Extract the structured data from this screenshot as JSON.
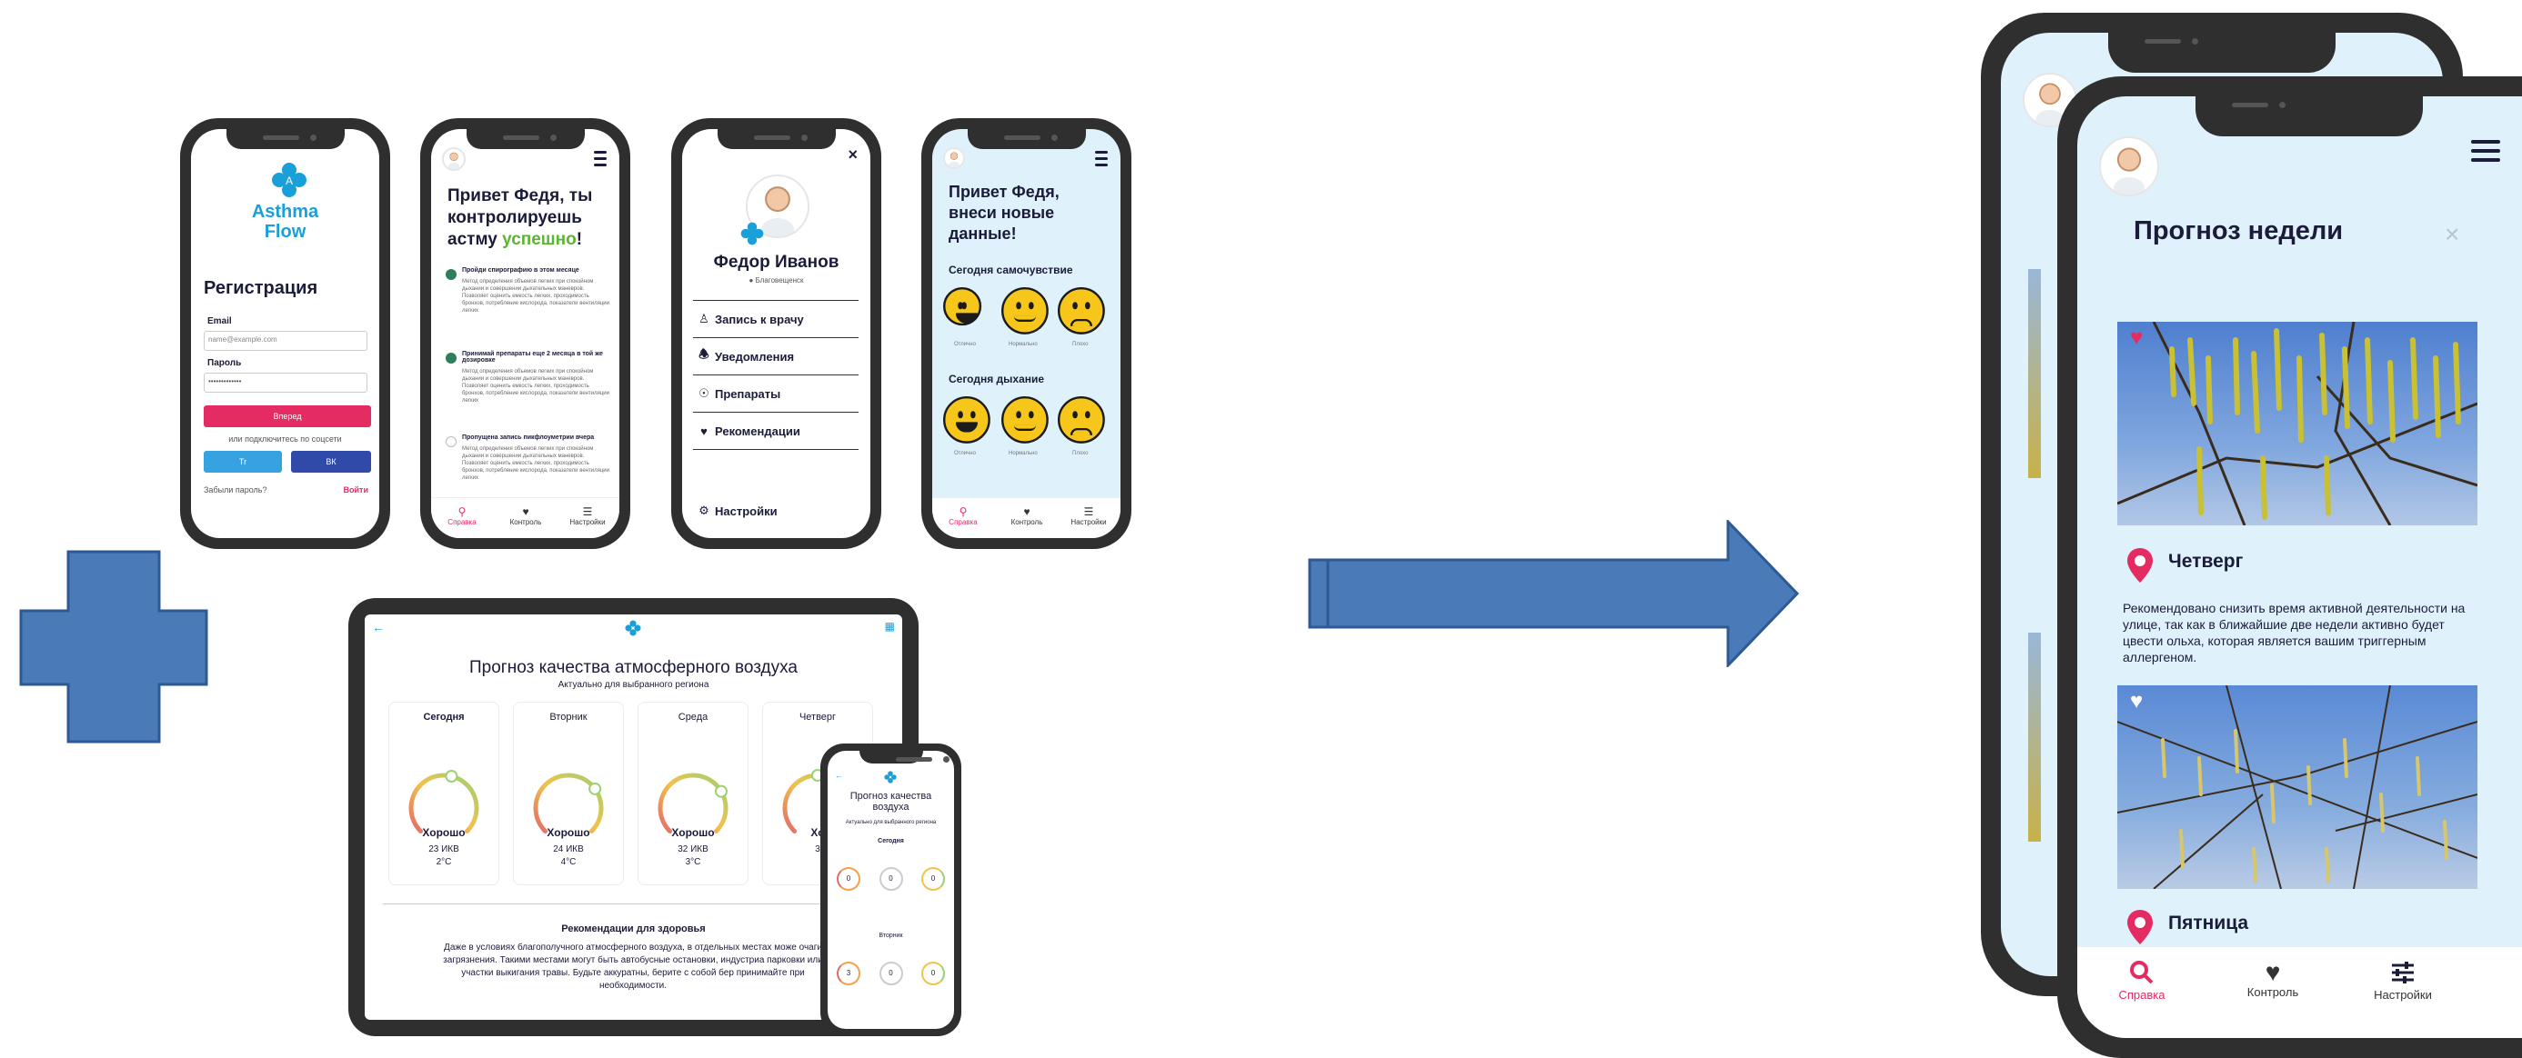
{
  "registration": {
    "logo_line1": "Asthma",
    "logo_line2": "Flow",
    "title": "Регистрация",
    "email_label": "Email",
    "email_placeholder": "name@example.com",
    "password_label": "Пароль",
    "password_value": "•••••••••••••",
    "submit": "Вперед",
    "social_text": "или подключитесь по соцсети",
    "tw": "Tr",
    "vk": "ВК",
    "forgot": "Забыли пароль?",
    "login": "Войти"
  },
  "greeting": {
    "title_part": "Привет Федя, ты контролируешь астму ",
    "title_accent": "успешно",
    "title_end": "!",
    "tasks": [
      {
        "title": "Пройди спирографию в этом месяце",
        "desc": "Метод определения объемов легких при спокойном дыхании и совершении дыхательных маневров. Позволяет оценить емкость легких, проходимость бронхов, потребление кислорода, показатели вентиляции легких"
      },
      {
        "title": "Принимай препараты еще 2 месяца в той же дозировке",
        "desc": "Метод определения объемов легких при спокойном дыхании и совершении дыхательных маневров. Позволяет оценить емкость легких, проходимость бронхов, потребление кислорода, показатели вентиляции легких"
      },
      {
        "title": "Пропущена запись пикфлоуметрии вчера",
        "desc": "Метод определения объемов легких при спокойном дыхании и совершении дыхательных маневров. Позволяет оценить емкость легких, проходимость бронхов, потребление кислорода, показатели вентиляции легких"
      }
    ]
  },
  "profile": {
    "name": "Федор Иванов",
    "city": "Благовещенск",
    "menu": [
      "Запись к врачу",
      "Уведомления",
      "Препараты",
      "Рекомендации"
    ],
    "settings": "Настройки"
  },
  "mood": {
    "title": "Привет Федя, внеси новые данные!",
    "wellbeing": "Сегодня самочувствие",
    "breathing": "Сегодня дыхание",
    "labels": [
      "Отлично",
      "Нормально",
      "Плохо"
    ]
  },
  "nav": {
    "help": "Справка",
    "control": "Контроль",
    "settings": "Настройки"
  },
  "tablet": {
    "title": "Прогноз качества атмосферного воздуха",
    "subtitle": "Актуально для выбранного региона",
    "days": [
      {
        "day": "Сегодня",
        "status": "Хорошо",
        "ikv": "23 ИКВ",
        "temp": "2°C",
        "level": 0.55
      },
      {
        "day": "Вторник",
        "status": "Хорошо",
        "ikv": "24 ИКВ",
        "temp": "4°C",
        "level": 0.7
      },
      {
        "day": "Среда",
        "status": "Хорошо",
        "ikv": "32 ИКВ",
        "temp": "3°C",
        "level": 0.72
      },
      {
        "day": "Четверг",
        "status": "Хо",
        "ikv": "3",
        "temp": "",
        "level": 0.5
      }
    ],
    "rec_title": "Рекомендации для здоровья",
    "rec_text": "Даже в условиях благополучного атмосферного воздуха, в отдельных местах може очаги загрязнения. Такими местами могут быть автобусные остановки, индустриа парковки или участки выкигания травы. Будьте аккуратны, берите с собой бер принимайте при необходимости."
  },
  "small_phone": {
    "title": "Прогноз качества воздуха",
    "subtitle": "Актуально для выбранного региона",
    "today": "Сегодня",
    "tuesday": "Вторник",
    "row1": [
      "0",
      "0",
      "0"
    ],
    "row2": [
      "3",
      "0",
      "0"
    ]
  },
  "result": {
    "title": "Прогноз недели",
    "close": "×",
    "day1": "Четверг",
    "day1_text": "Рекомендовано снизить время активной деятельности на улице, так как в ближайшие две недели активно будет цвести ольха, которая является вашим триггерным аллергеном.",
    "day2": "Пятница"
  },
  "colors": {
    "accent": "#e42c63",
    "arrow": "#4a7ab8",
    "brand": "#1aa0d8",
    "mood_bg": "#dff1fb"
  }
}
